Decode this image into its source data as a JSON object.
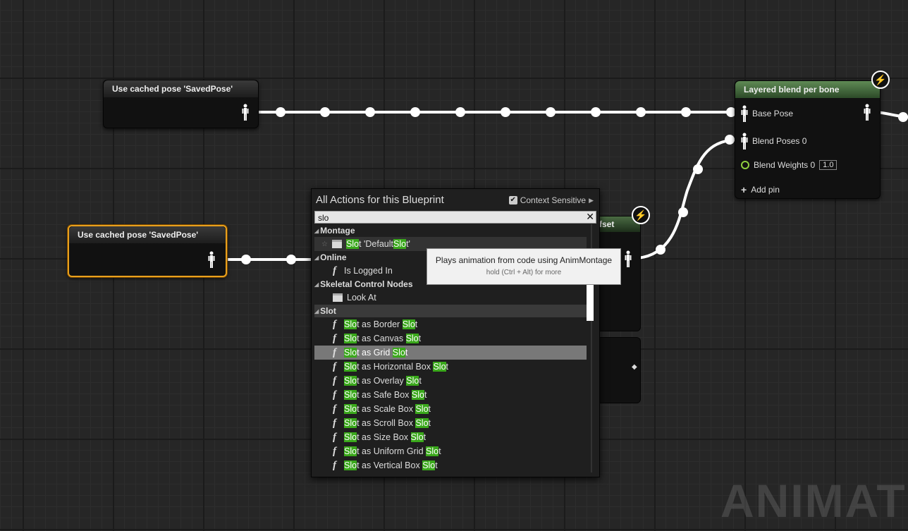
{
  "nodes": {
    "cached_top": {
      "title": "Use cached pose 'SavedPose'"
    },
    "cached_bottom": {
      "title": "Use cached pose 'SavedPose'"
    },
    "layered": {
      "title": "Layered blend per bone",
      "base_pose": "Base Pose",
      "blend_poses": "Blend Poses 0",
      "blend_weights": "Blend Weights 0",
      "blend_weight_value": "1.0",
      "add_pin": "Add pin"
    },
    "hidden_node_title_fragment": "fset"
  },
  "menu": {
    "title": "All Actions for this Blueprint",
    "context_sensitive": "Context Sensitive",
    "search_value": "slo",
    "categories": {
      "montage": "Montage",
      "online": "Online",
      "skeletal": "Skeletal Control Nodes",
      "slot": "Slot"
    },
    "items": {
      "default_slot": {
        "pre": "",
        "m1": "Slo",
        "mid": "t 'Default",
        "m2": "Slo",
        "post": "t'"
      },
      "is_logged_in": "Is Logged In",
      "look_at": "Look At",
      "slot_items": [
        {
          "m1": "Slo",
          "mid": "t as Border ",
          "m2": "Slo",
          "post": "t"
        },
        {
          "m1": "Slo",
          "mid": "t as Canvas ",
          "m2": "Slo",
          "post": "t"
        },
        {
          "m1": "Slo",
          "mid": "t as Grid ",
          "m2": "Slo",
          "post": "t"
        },
        {
          "m1": "Slo",
          "mid": "t as Horizontal Box ",
          "m2": "Slo",
          "post": "t"
        },
        {
          "m1": "Slo",
          "mid": "t as Overlay ",
          "m2": "Slo",
          "post": "t"
        },
        {
          "m1": "Slo",
          "mid": "t as Safe Box ",
          "m2": "Slo",
          "post": "t"
        },
        {
          "m1": "Slo",
          "mid": "t as Scale Box ",
          "m2": "Slo",
          "post": "t"
        },
        {
          "m1": "Slo",
          "mid": "t as Scroll Box ",
          "m2": "Slo",
          "post": "t"
        },
        {
          "m1": "Slo",
          "mid": "t as Size Box ",
          "m2": "Slo",
          "post": "t"
        },
        {
          "m1": "Slo",
          "mid": "t as Uniform Grid ",
          "m2": "Slo",
          "post": "t"
        },
        {
          "m1": "Slo",
          "mid": "t as Vertical Box ",
          "m2": "Slo",
          "post": "t"
        }
      ]
    }
  },
  "tooltip": {
    "main": "Plays animation from code using AnimMontage",
    "hint": "hold (Ctrl + Alt) for more"
  },
  "watermark": "ANIMATION",
  "colors": {
    "highlight": "#3aa81b",
    "selected_outline": "#e8a01d",
    "layered_header": "#4f7a45"
  }
}
